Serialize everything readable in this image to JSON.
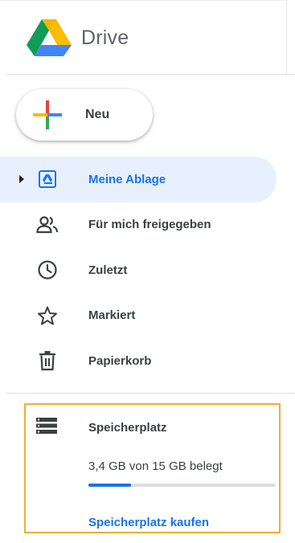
{
  "app": {
    "name": "Drive",
    "logo_icon": "google-drive-logo"
  },
  "new_button": {
    "label": "Neu",
    "icon": "plus-icon"
  },
  "nav": {
    "items": [
      {
        "label": "Meine Ablage",
        "icon": "my-drive-icon",
        "active": true
      },
      {
        "label": "Für mich freigegeben",
        "icon": "people-icon",
        "active": false
      },
      {
        "label": "Zuletzt",
        "icon": "clock-icon",
        "active": false
      },
      {
        "label": "Markiert",
        "icon": "star-icon",
        "active": false
      },
      {
        "label": "Papierkorb",
        "icon": "trash-icon",
        "active": false
      }
    ]
  },
  "storage": {
    "title": "Speicherplatz",
    "icon": "storage-icon",
    "usage_text": "3,4 GB von 15 GB belegt",
    "usage_fraction": 0.227,
    "buy_label": "Speicherplatz kaufen"
  },
  "colors": {
    "accent": "#1a73e8",
    "active_bg": "#e8f0fe",
    "highlight_border": "#f0ad3a"
  }
}
